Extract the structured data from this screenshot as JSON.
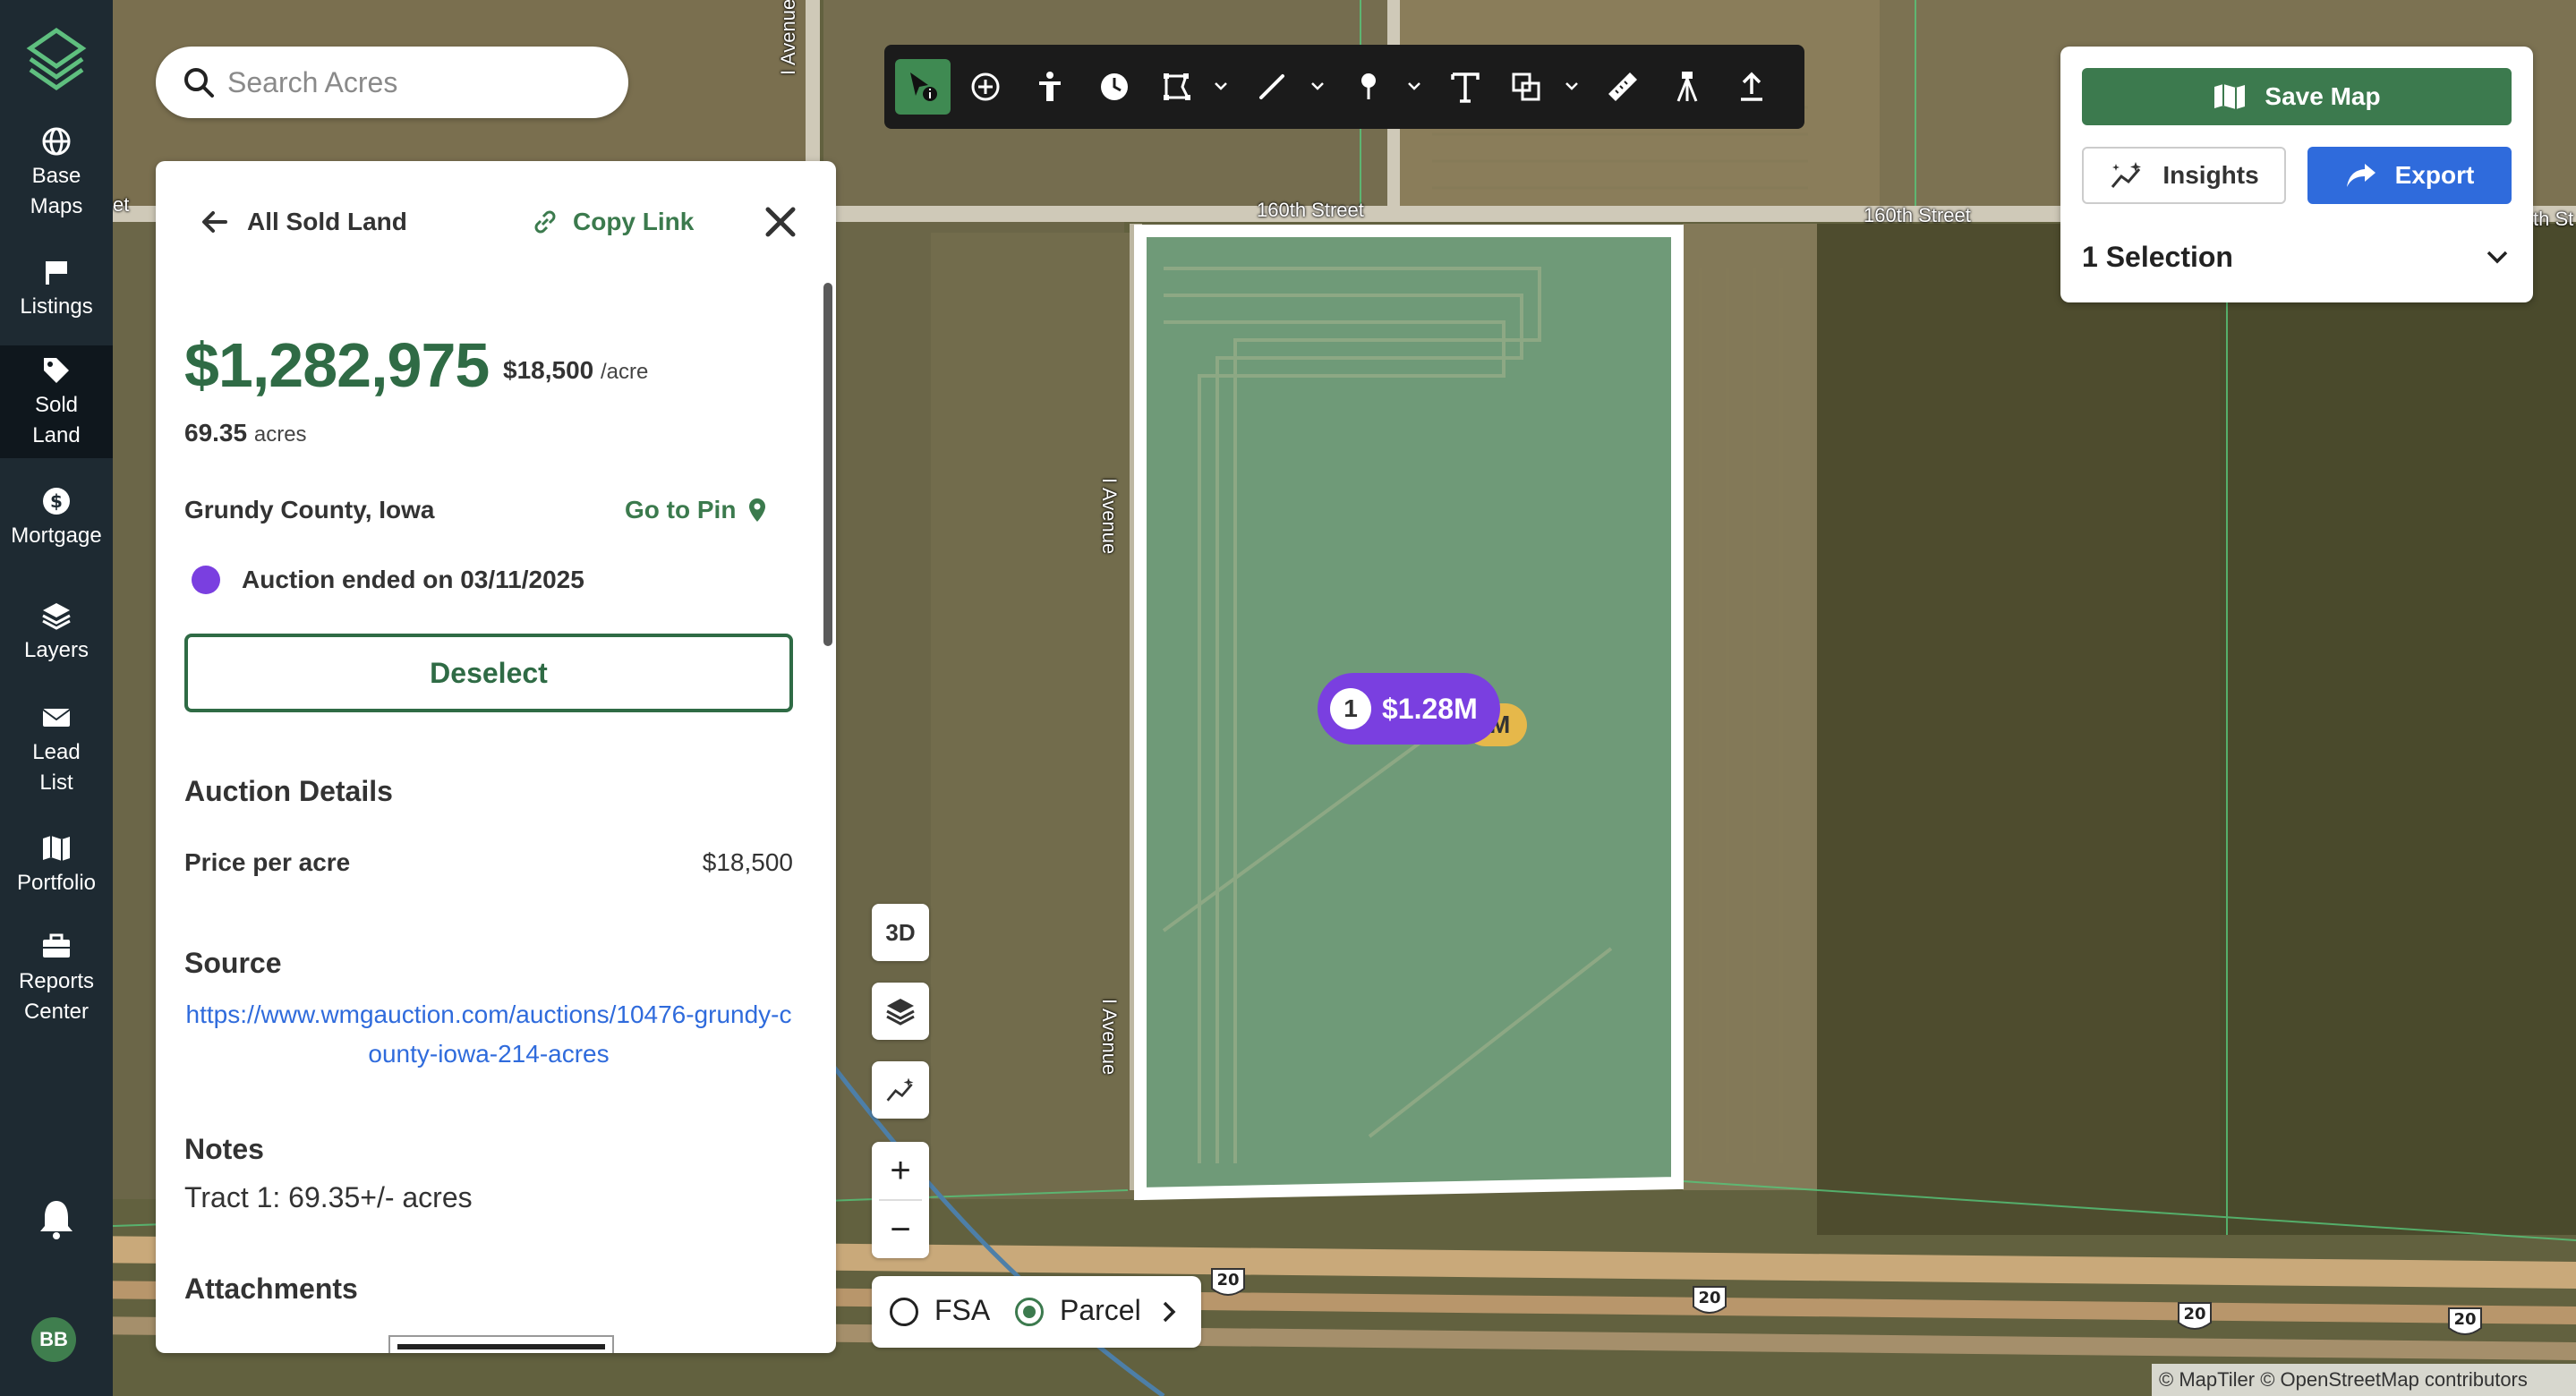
{
  "nav": {
    "items": [
      {
        "label": "Base Maps"
      },
      {
        "label": "Listings"
      },
      {
        "label": "Sold Land"
      },
      {
        "label": "Mortgage"
      },
      {
        "label": "Layers"
      },
      {
        "label": "Lead List"
      },
      {
        "label": "Portfolio"
      },
      {
        "label": "Reports Center"
      }
    ],
    "active": "Sold Land",
    "avatar": "BB"
  },
  "search": {
    "placeholder": "Search Acres"
  },
  "panel": {
    "back_label": "All Sold Land",
    "copy_label": "Copy Link",
    "price": "$1,282,975",
    "price_per": "$18,500",
    "price_per_unit": "/acre",
    "acres": "69.35",
    "acres_unit": "acres",
    "county": "Grundy County, Iowa",
    "goto_pin": "Go to Pin",
    "status": "Auction ended on 03/11/2025",
    "status_color": "#7a3fe0",
    "deselect": "Deselect",
    "auction_details_title": "Auction Details",
    "price_per_acre_label": "Price per acre",
    "price_per_acre_value": "$18,500",
    "source_title": "Source",
    "source_url": "https://www.wmgauction.com/auctions/10476-grundy-county-iowa-214-acres",
    "notes_title": "Notes",
    "notes_text": "Tract 1: 69.35+/- acres",
    "attachments_title": "Attachments"
  },
  "right_panel": {
    "save_map": "Save Map",
    "insights": "Insights",
    "export": "Export",
    "selection": "1 Selection"
  },
  "map": {
    "controls": {
      "three_d": "3D"
    },
    "layer_toggle": {
      "fsa": "FSA",
      "parcel": "Parcel",
      "selected": "Parcel"
    },
    "marker": {
      "count": "1",
      "price": "$1.28M",
      "under": "M"
    },
    "road_labels": {
      "street_a": "160th Street",
      "street_b": "160th Street",
      "street_c": "th St",
      "street_left": "et",
      "avenue_top": "I Avenue",
      "avenue_mid": "I Avenue",
      "avenue_low": "I Avenue"
    },
    "highway_shields": [
      "20",
      "20",
      "20",
      "20"
    ],
    "attribution": "© MapTiler © OpenStreetMap contributors"
  },
  "colors": {
    "brand_green": "#3c7a4e",
    "link_blue": "#2f6bdc",
    "nav_bg": "#1e2a32"
  }
}
